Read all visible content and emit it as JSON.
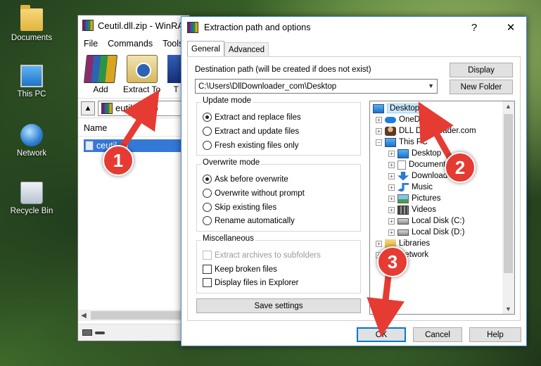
{
  "desktop": {
    "icons": [
      {
        "label": "Documents",
        "icon": "documents-folder-icon"
      },
      {
        "label": "This PC",
        "icon": "this-pc-icon"
      },
      {
        "label": "Network",
        "icon": "network-icon"
      },
      {
        "label": "Recycle Bin",
        "icon": "recycle-bin-icon"
      }
    ]
  },
  "winrar": {
    "title": "Ceutil.dll.zip - WinRA",
    "menu": [
      "File",
      "Commands",
      "Tools"
    ],
    "toolbar": {
      "add": "Add",
      "extract_to": "Extract To",
      "third": "T"
    },
    "address": "eutil.dll.zip",
    "column_name": "Name",
    "file": "ceutil.dll"
  },
  "dialog": {
    "title": "Extraction path and options",
    "help_glyph": "?",
    "close_glyph": "✕",
    "tabs": [
      "General",
      "Advanced"
    ],
    "dest_label": "Destination path (will be created if does not exist)",
    "dest_value": "C:\\Users\\DllDownloader_com\\Desktop",
    "display_btn": "Display",
    "new_folder_btn": "New Folder",
    "update_mode": {
      "title": "Update mode",
      "options": [
        "Extract and replace files",
        "Extract and update files",
        "Fresh existing files only"
      ],
      "selected": 0
    },
    "overwrite_mode": {
      "title": "Overwrite mode",
      "options": [
        "Ask before overwrite",
        "Overwrite without prompt",
        "Skip existing files",
        "Rename automatically"
      ],
      "selected": 0
    },
    "misc": {
      "title": "Miscellaneous",
      "options": [
        "Extract archives to subfolders",
        "Keep broken files",
        "Display files in Explorer"
      ]
    },
    "save_settings": "Save settings",
    "tree": [
      {
        "label": "Desktop",
        "icon": "desktop-icon"
      },
      {
        "label": "OneDrive",
        "icon": "onedrive-icon"
      },
      {
        "label": "DLL Downloader.com",
        "icon": "user-icon"
      },
      {
        "label": "This PC",
        "icon": "this-pc-icon"
      },
      {
        "label": "Desktop",
        "icon": "desktop-icon"
      },
      {
        "label": "Documents",
        "icon": "documents-icon"
      },
      {
        "label": "Downloads",
        "icon": "downloads-icon"
      },
      {
        "label": "Music",
        "icon": "music-icon"
      },
      {
        "label": "Pictures",
        "icon": "pictures-icon"
      },
      {
        "label": "Videos",
        "icon": "videos-icon"
      },
      {
        "label": "Local Disk (C:)",
        "icon": "disk-icon"
      },
      {
        "label": "Local Disk (D:)",
        "icon": "disk-icon"
      },
      {
        "label": "Libraries",
        "icon": "libraries-icon"
      },
      {
        "label": "Network",
        "icon": "network-icon"
      }
    ],
    "ok": "OK",
    "cancel": "Cancel",
    "help": "Help"
  },
  "annotations": {
    "step1": "1",
    "step2": "2",
    "step3": "3",
    "color": "#e53b33"
  }
}
